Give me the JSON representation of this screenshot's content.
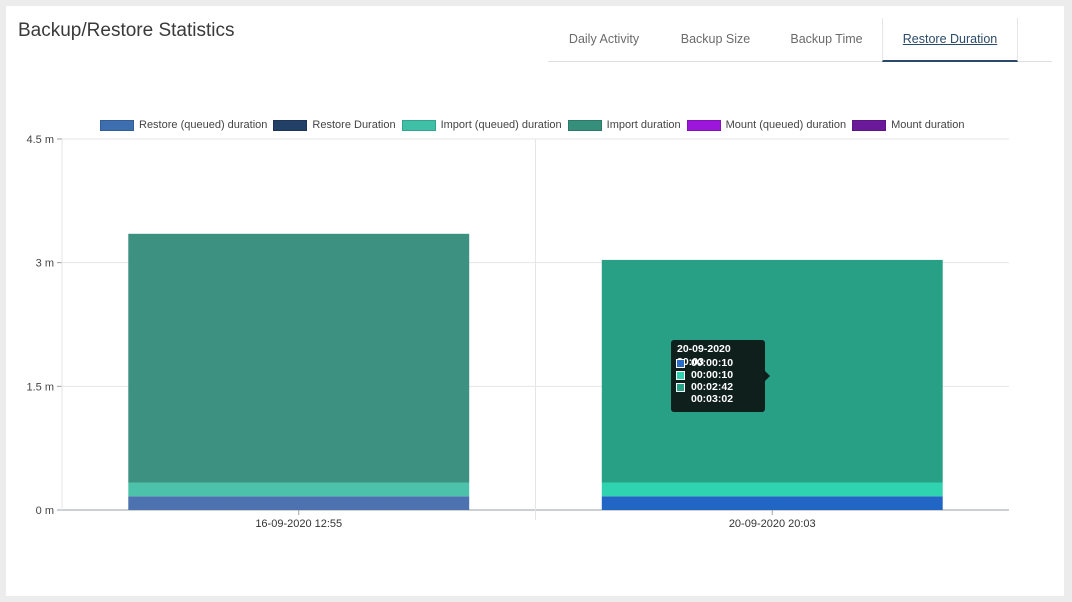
{
  "header": {
    "title": "Backup/Restore Statistics"
  },
  "tabs": [
    {
      "label": "Daily Activity"
    },
    {
      "label": "Backup Size"
    },
    {
      "label": "Backup Time"
    },
    {
      "label": "Restore Duration",
      "active": true
    }
  ],
  "tooltip": {
    "title": "20-09-2020 20:03",
    "rows": [
      {
        "value": "00:00:10",
        "color": "#2b6cc4"
      },
      {
        "value": "00:00:10",
        "color": "#2fd3b0"
      },
      {
        "value": "00:02:42",
        "color": "#27a085"
      }
    ],
    "total": "00:03:02"
  },
  "chart_data": {
    "type": "bar",
    "stacked": true,
    "categories": [
      "16-09-2020 12:55",
      "20-09-2020 20:03"
    ],
    "yticks": [
      "0 m",
      "1.5 m",
      "3 m",
      "4.5 m"
    ],
    "ylim": [
      0,
      4.5
    ],
    "yunit": "m",
    "grid": true,
    "legend_position": "top",
    "series": [
      {
        "name": "Restore (queued) duration",
        "color": "#3d6fb0",
        "bar_colors": [
          "#4c72b0",
          "#2166c4"
        ],
        "values": [
          0.1667,
          0.1667
        ]
      },
      {
        "name": "Restore Duration",
        "color": "#223f66",
        "values": [
          0,
          0
        ]
      },
      {
        "name": "Import (queued) duration",
        "color": "#3fbfa5",
        "bar_colors": [
          "#4cc2aa",
          "#2fd3b0"
        ],
        "values": [
          0.1667,
          0.1667
        ]
      },
      {
        "name": "Import duration",
        "color": "#358f7a",
        "bar_colors": [
          "#3d9180",
          "#27a085"
        ],
        "values": [
          3.0167,
          2.7
        ]
      },
      {
        "name": "Mount (queued) duration",
        "color": "#9b17d9",
        "values": [
          0,
          0
        ]
      },
      {
        "name": "Mount duration",
        "color": "#6a1a99",
        "values": [
          0,
          0
        ]
      }
    ]
  }
}
